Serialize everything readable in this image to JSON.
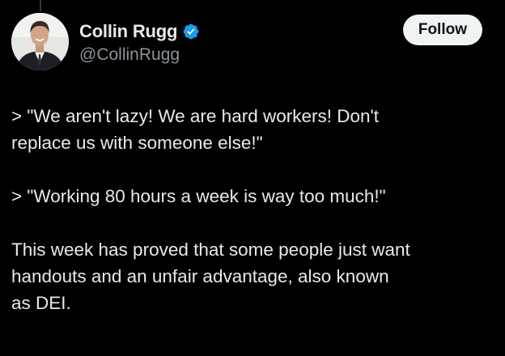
{
  "tweet": {
    "author": {
      "display_name": "Collin Rugg",
      "handle": "@CollinRugg",
      "verified": true,
      "avatar_icon": "profile-photo"
    },
    "follow_label": "Follow",
    "paragraphs": [
      "> \"We aren't lazy! We are hard workers! Don't\nreplace us with someone else!\"",
      "> \"Working 80 hours a week is way too much!\"",
      "This week has proved that some people just want\nhandouts and an unfair advantage, also known\nas DEI."
    ]
  },
  "colors": {
    "background": "#000000",
    "text": "#e7e9ea",
    "secondary_text": "#8b9298",
    "verified_badge": "#1d9bf0",
    "follow_button_bg": "#eff3f4",
    "follow_button_text": "#0f1419"
  }
}
